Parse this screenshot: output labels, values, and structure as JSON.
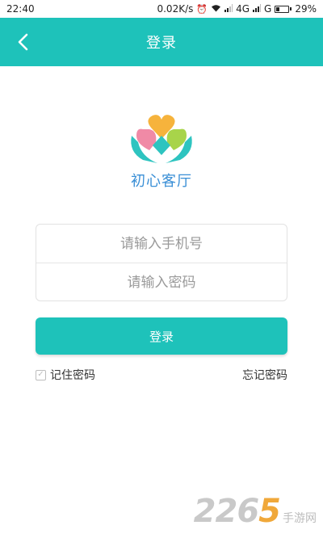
{
  "status_bar": {
    "time": "22:40",
    "speed": "0.02K/s",
    "network_4g": "4G",
    "network_g": "G",
    "battery": "29%",
    "battery_level": 0.29
  },
  "header": {
    "title": "登录",
    "back_icon": "chevron-left-icon"
  },
  "logo": {
    "text": "初心客厅",
    "colors": {
      "orange": "#f6b33c",
      "pink": "#f08aa6",
      "green": "#a8d44a",
      "teal": "#2ec4c0",
      "text": "#3a8fd6"
    }
  },
  "form": {
    "phone_placeholder": "请输入手机号",
    "phone_value": "",
    "password_placeholder": "请输入密码",
    "password_value": ""
  },
  "login_button": "登录",
  "remember_password": "记住密码",
  "remember_checked": true,
  "forgot_password": "忘记密码",
  "watermark": {
    "number_a": "22",
    "number_b": "6",
    "number_c": "5",
    "site": "手游网"
  },
  "colors": {
    "accent": "#1ec2ba"
  }
}
